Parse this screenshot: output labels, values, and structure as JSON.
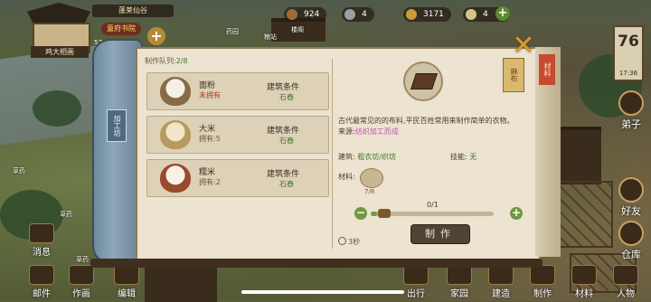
{
  "top_bar": {
    "realm": "蓬莱仙谷",
    "resources": [
      {
        "icon": "lumber-icon",
        "value": "924"
      },
      {
        "icon": "stone-icon",
        "value": "4"
      },
      {
        "icon": "coin-icon",
        "value": "3171"
      },
      {
        "icon": "scroll-icon",
        "value": "4"
      }
    ],
    "plus": "+"
  },
  "player": {
    "name": "鸡大相画",
    "rank": "童府书院",
    "stat": "57 45"
  },
  "scene_labels": [
    "粮站",
    "药园",
    "楼阁",
    "草药",
    "草药",
    "草药"
  ],
  "calendar": {
    "day": "76",
    "time": "17:36"
  },
  "side_buttons": [
    {
      "label": "弟子",
      "icon": "disciple-icon"
    },
    {
      "label": "好友",
      "icon": "friends-icon"
    },
    {
      "label": "仓库",
      "icon": "warehouse-icon"
    },
    {
      "label": "人物",
      "icon": "character-icon"
    }
  ],
  "bottom_buttons": [
    {
      "label": "消息",
      "icon": "message-icon"
    },
    {
      "label": "邮件",
      "icon": "mail-icon"
    },
    {
      "label": "作画",
      "icon": "paint-icon"
    },
    {
      "label": "编辑",
      "icon": "edit-icon"
    },
    {
      "label": "出行",
      "icon": "travel-icon"
    },
    {
      "label": "家园",
      "icon": "home-icon"
    },
    {
      "label": "建造",
      "icon": "build-icon"
    },
    {
      "label": "制作",
      "icon": "craft-icon"
    },
    {
      "label": "材料",
      "icon": "material-icon"
    },
    {
      "label": "人物",
      "icon": "person-icon"
    }
  ],
  "dialog": {
    "scroll_tag": "加工坊",
    "queue_label": "制作队列:",
    "queue_value": "2/8",
    "recipes": [
      {
        "name": "面粉",
        "own": "未拥有",
        "own_red": true,
        "cond_label": "建筑条件",
        "cond_value": "石舂"
      },
      {
        "name": "大米",
        "own": "拥有:5",
        "own_red": false,
        "cond_label": "建筑条件",
        "cond_value": "石舂"
      },
      {
        "name": "糯米",
        "own": "拥有:2",
        "own_red": false,
        "cond_label": "建筑条件",
        "cond_value": "石舂"
      }
    ],
    "detail": {
      "item_name": "麻布",
      "description": "古代最常见的的布料,平民百姓常用来制作简单的衣物。",
      "source_label": "来源:",
      "source_value": "纺织加工而成",
      "building_label": "建筑:",
      "building_value": "粗衣坊/织坊",
      "skill_label": "技能:",
      "skill_value": "无",
      "material_label": "材料:",
      "material_count": "7/8",
      "slider_count": "0/1",
      "slider_fraction": 0.05,
      "make_button": "制作",
      "time": "3秒",
      "ribbon": "材料"
    }
  }
}
